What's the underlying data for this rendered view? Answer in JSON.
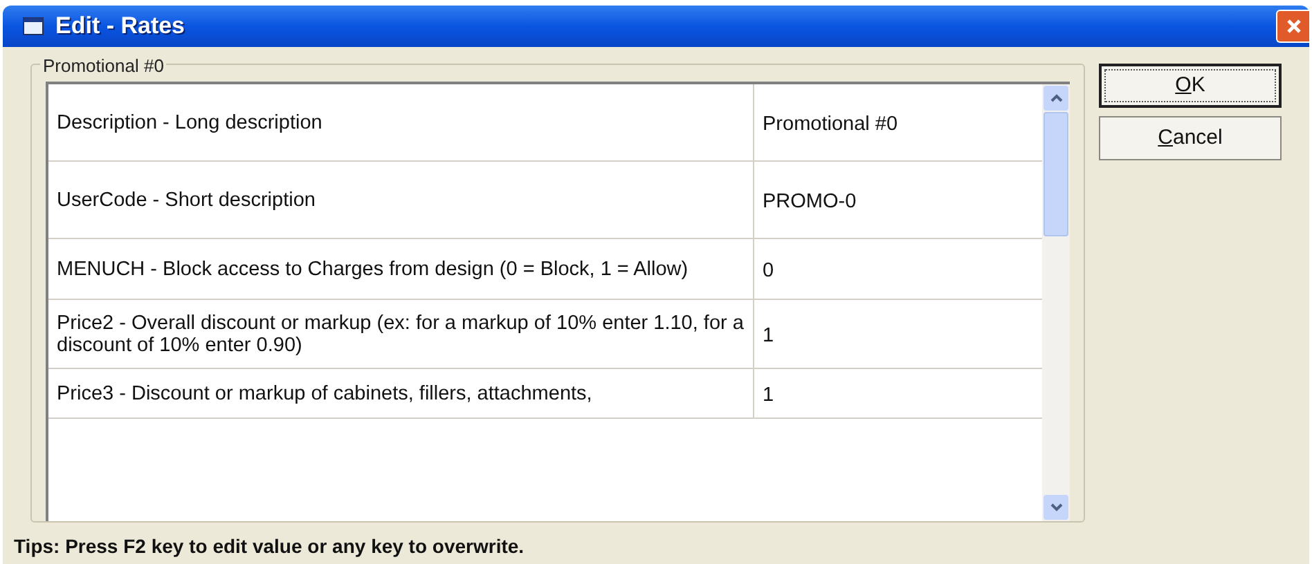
{
  "window": {
    "title": "Edit - Rates"
  },
  "group": {
    "title": "Promotional #0"
  },
  "rows": [
    {
      "property": "Description - Long description",
      "value": "Promotional #0"
    },
    {
      "property": "UserCode - Short description",
      "value": "PROMO-0"
    },
    {
      "property": "MENUCH - Block access to Charges from design (0 = Block, 1 = Allow)",
      "value": "0"
    },
    {
      "property": "Price2 - Overall discount or markup (ex: for a markup of 10% enter 1.10, for a discount of 10% enter 0.90)",
      "value": "1"
    },
    {
      "property": "Price3 - Discount or markup of cabinets, fillers, attachments,",
      "value": "1"
    }
  ],
  "buttons": [
    {
      "label": "OK",
      "default": true
    },
    {
      "label": "Cancel",
      "default": false
    }
  ],
  "tips": "Tips: Press F2 key to edit value or any key to overwrite."
}
